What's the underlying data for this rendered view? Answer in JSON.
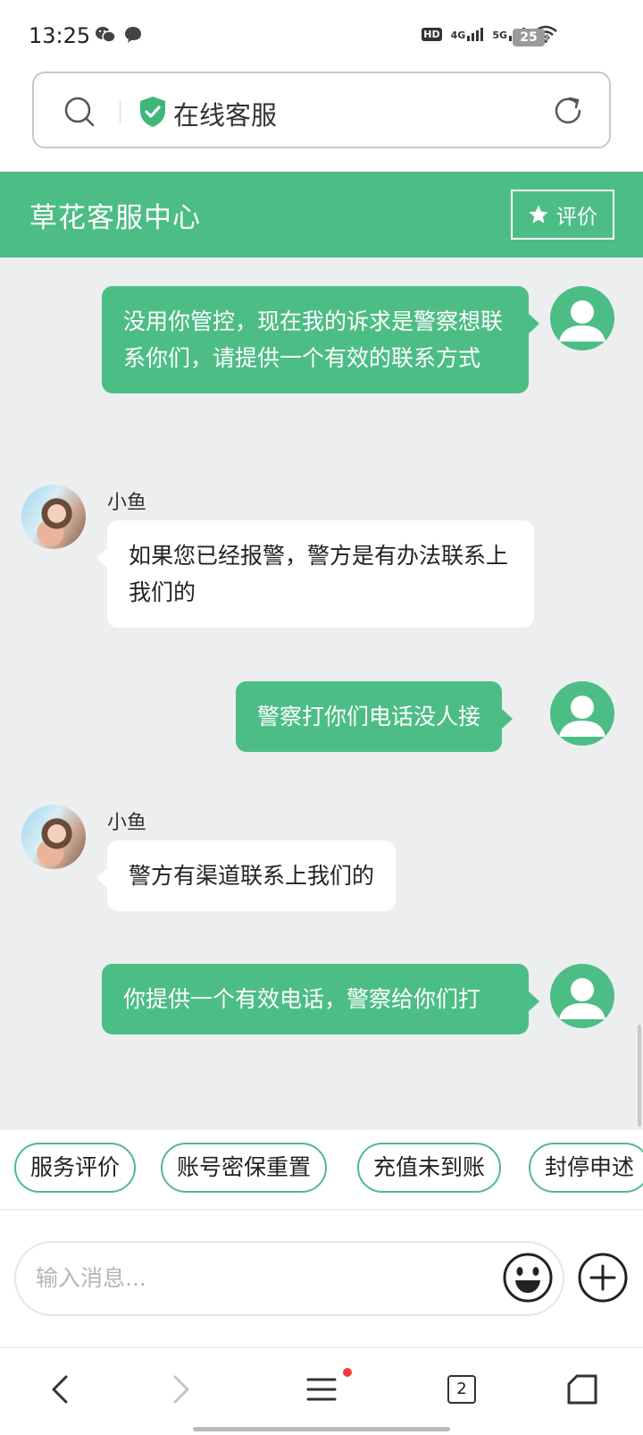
{
  "status_bar": {
    "time": "13:25",
    "network_1": "HD",
    "network_2": "4G",
    "network_3": "5G",
    "battery": "25"
  },
  "address_bar": {
    "title": "在线客服"
  },
  "header": {
    "title": "草花客服中心",
    "rate_label": "评价"
  },
  "messages": [
    {
      "sender": "user",
      "text": "没用你管控，现在我的诉求是警察想联系你们，请提供一个有效的联系方式"
    },
    {
      "sender": "agent",
      "name": "小鱼",
      "text": "如果您已经报警，警方是有办法联系上我们的"
    },
    {
      "sender": "user",
      "text": "警察打你们电话没人接"
    },
    {
      "sender": "agent",
      "name": "小鱼",
      "text": "警方有渠道联系上我们的"
    },
    {
      "sender": "user",
      "text": "你提供一个有效电话，警察给你们打"
    }
  ],
  "quick_replies": [
    "服务评价",
    "账号密保重置",
    "充值未到账",
    "封停申述"
  ],
  "input": {
    "placeholder": "输入消息..."
  },
  "browser_nav": {
    "tab_count": "2"
  },
  "colors": {
    "accent": "#4dbd86",
    "chat_background": "#eceeef"
  }
}
